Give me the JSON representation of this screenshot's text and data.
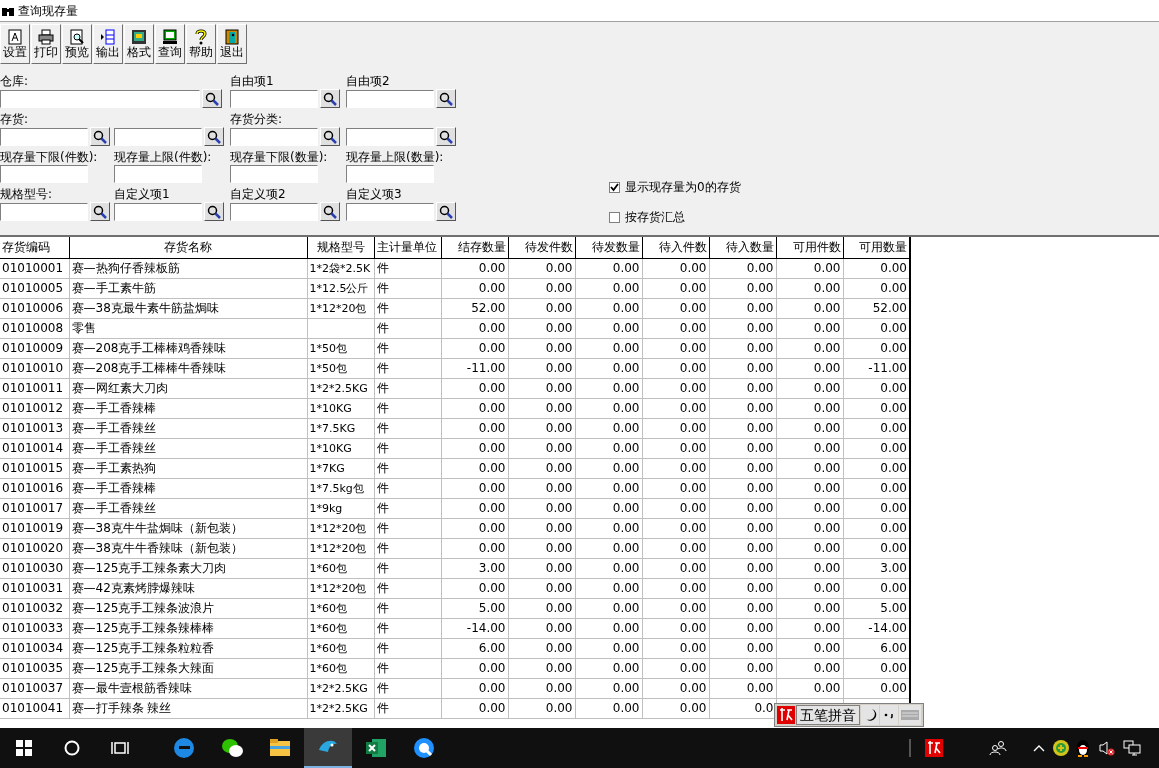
{
  "window": {
    "title": "查询现存量"
  },
  "toolbar": [
    {
      "label": "设置"
    },
    {
      "label": "打印"
    },
    {
      "label": "预览"
    },
    {
      "label": "输出"
    },
    {
      "label": "格式"
    },
    {
      "label": "查询"
    },
    {
      "label": "帮助"
    },
    {
      "label": "退出"
    }
  ],
  "filters": [
    [
      {
        "label": "仓库:",
        "kind": "wide_lookup"
      },
      {
        "label": "自由项1",
        "kind": "lookup"
      },
      {
        "label": "自由项2",
        "kind": "lookup"
      }
    ],
    [
      {
        "label": "存货:",
        "kind": "lookup"
      },
      {
        "kind": "lookup"
      },
      {
        "label": "存货分类:",
        "kind": "lookup"
      },
      {
        "kind": "lookup"
      }
    ],
    [
      {
        "label": "现存量下限(件数):",
        "kind": "text"
      },
      {
        "label": "现存量上限(件数):",
        "kind": "text"
      },
      {
        "label": "现存量下限(数量):",
        "kind": "text"
      },
      {
        "label": "现存量上限(数量):",
        "kind": "text"
      }
    ],
    [
      {
        "label": "规格型号:",
        "kind": "lookup"
      },
      {
        "label": "自定义项1",
        "kind": "lookup"
      },
      {
        "label": "自定义项2",
        "kind": "lookup"
      },
      {
        "label": "自定义项3",
        "kind": "lookup"
      }
    ]
  ],
  "options": [
    {
      "label": "显示现存量为0的存货",
      "checked": true
    },
    {
      "label": "按存货汇总",
      "checked": false
    }
  ],
  "table": {
    "columns": [
      "存货编码",
      "存货名称",
      "规格型号",
      "主计量单位",
      "结存数量",
      "待发件数",
      "待发数量",
      "待入件数",
      "待入数量",
      "可用件数",
      "可用数量"
    ],
    "rows": [
      [
        "01010001",
        "赛—热狗仔香辣板筋",
        "1*2袋*2.5K",
        "件",
        "0.00",
        "0.00",
        "0.00",
        "0.00",
        "0.00",
        "0.00",
        "0.00"
      ],
      [
        "01010005",
        "赛—手工素牛筋",
        "1*12.5公斤",
        "件",
        "0.00",
        "0.00",
        "0.00",
        "0.00",
        "0.00",
        "0.00",
        "0.00"
      ],
      [
        "01010006",
        "赛—38克最牛素牛筋盐焗味",
        "1*12*20包",
        "件",
        "52.00",
        "0.00",
        "0.00",
        "0.00",
        "0.00",
        "0.00",
        "52.00"
      ],
      [
        "01010008",
        "零售",
        "",
        "件",
        "0.00",
        "0.00",
        "0.00",
        "0.00",
        "0.00",
        "0.00",
        "0.00"
      ],
      [
        "01010009",
        "赛—208克手工棒棒鸡香辣味",
        "1*50包",
        "件",
        "0.00",
        "0.00",
        "0.00",
        "0.00",
        "0.00",
        "0.00",
        "0.00"
      ],
      [
        "01010010",
        "赛—208克手工棒棒牛香辣味",
        "1*50包",
        "件",
        "-11.00",
        "0.00",
        "0.00",
        "0.00",
        "0.00",
        "0.00",
        "-11.00"
      ],
      [
        "01010011",
        "赛—网红素大刀肉",
        "1*2*2.5KG",
        "件",
        "0.00",
        "0.00",
        "0.00",
        "0.00",
        "0.00",
        "0.00",
        "0.00"
      ],
      [
        "01010012",
        "赛—手工香辣棒",
        "1*10KG",
        "件",
        "0.00",
        "0.00",
        "0.00",
        "0.00",
        "0.00",
        "0.00",
        "0.00"
      ],
      [
        "01010013",
        "赛—手工香辣丝",
        "1*7.5KG",
        "件",
        "0.00",
        "0.00",
        "0.00",
        "0.00",
        "0.00",
        "0.00",
        "0.00"
      ],
      [
        "01010014",
        "赛—手工香辣丝",
        "1*10KG",
        "件",
        "0.00",
        "0.00",
        "0.00",
        "0.00",
        "0.00",
        "0.00",
        "0.00"
      ],
      [
        "01010015",
        "赛—手工素热狗",
        "1*7KG",
        "件",
        "0.00",
        "0.00",
        "0.00",
        "0.00",
        "0.00",
        "0.00",
        "0.00"
      ],
      [
        "01010016",
        "赛—手工香辣棒",
        "1*7.5kg包",
        "件",
        "0.00",
        "0.00",
        "0.00",
        "0.00",
        "0.00",
        "0.00",
        "0.00"
      ],
      [
        "01010017",
        "赛—手工香辣丝",
        "1*9kg",
        "件",
        "0.00",
        "0.00",
        "0.00",
        "0.00",
        "0.00",
        "0.00",
        "0.00"
      ],
      [
        "01010019",
        "赛—38克牛牛盐焗味（新包装）",
        "1*12*20包",
        "件",
        "0.00",
        "0.00",
        "0.00",
        "0.00",
        "0.00",
        "0.00",
        "0.00"
      ],
      [
        "01010020",
        "赛—38克牛牛香辣味（新包装）",
        "1*12*20包",
        "件",
        "0.00",
        "0.00",
        "0.00",
        "0.00",
        "0.00",
        "0.00",
        "0.00"
      ],
      [
        "01010030",
        "赛—125克手工辣条素大刀肉",
        "1*60包",
        "件",
        "3.00",
        "0.00",
        "0.00",
        "0.00",
        "0.00",
        "0.00",
        "3.00"
      ],
      [
        "01010031",
        "赛—42克素烤脖爆辣味",
        "1*12*20包",
        "件",
        "0.00",
        "0.00",
        "0.00",
        "0.00",
        "0.00",
        "0.00",
        "0.00"
      ],
      [
        "01010032",
        "赛—125克手工辣条波浪片",
        "1*60包",
        "件",
        "5.00",
        "0.00",
        "0.00",
        "0.00",
        "0.00",
        "0.00",
        "5.00"
      ],
      [
        "01010033",
        "赛—125克手工辣条辣棒棒",
        "1*60包",
        "件",
        "-14.00",
        "0.00",
        "0.00",
        "0.00",
        "0.00",
        "0.00",
        "-14.00"
      ],
      [
        "01010034",
        "赛—125克手工辣条粒粒香",
        "1*60包",
        "件",
        "6.00",
        "0.00",
        "0.00",
        "0.00",
        "0.00",
        "0.00",
        "6.00"
      ],
      [
        "01010035",
        "赛—125克手工辣条大辣面",
        "1*60包",
        "件",
        "0.00",
        "0.00",
        "0.00",
        "0.00",
        "0.00",
        "0.00",
        "0.00"
      ],
      [
        "01010037",
        "赛—最牛壹根筋香辣味",
        "1*2*2.5KG",
        "件",
        "0.00",
        "0.00",
        "0.00",
        "0.00",
        "0.00",
        "0.00",
        "0.00"
      ],
      [
        "01010041",
        "赛—打手辣条 辣丝",
        "1*2*2.5KG",
        "件",
        "0.00",
        "0.00",
        "0.00",
        "0.00",
        "0.0",
        "",
        ""
      ]
    ]
  },
  "ime": {
    "label": "五笔拼音"
  },
  "taskbar": {
    "apps": [
      {
        "selected": false
      },
      {
        "selected": false
      },
      {
        "selected": false
      },
      {
        "selected": true
      },
      {
        "selected": false
      },
      {
        "selected": false
      }
    ]
  }
}
